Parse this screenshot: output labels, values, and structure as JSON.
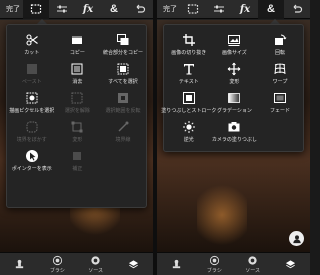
{
  "toolbar": {
    "done_label": "完了"
  },
  "left_menu": {
    "items": [
      {
        "label": "カット",
        "icon": "scissors-icon",
        "disabled": false
      },
      {
        "label": "コピー",
        "icon": "copy-icon",
        "disabled": false
      },
      {
        "label": "統合部分をコピー",
        "icon": "copy-merged-icon",
        "disabled": false
      },
      {
        "label": "ペースト",
        "icon": "paste-icon",
        "disabled": true
      },
      {
        "label": "消去",
        "icon": "clear-icon",
        "disabled": false
      },
      {
        "label": "すべてを選択",
        "icon": "select-all-icon",
        "disabled": false
      },
      {
        "label": "描画ピクセルを選択",
        "icon": "select-pixels-icon",
        "disabled": false
      },
      {
        "label": "選択を解除",
        "icon": "deselect-icon",
        "disabled": true
      },
      {
        "label": "選択範囲を反転",
        "icon": "invert-icon",
        "disabled": true
      },
      {
        "label": "境界をぼかす",
        "icon": "feather-icon",
        "disabled": true
      },
      {
        "label": "変形",
        "icon": "transform-icon",
        "disabled": true
      },
      {
        "label": "境界線",
        "icon": "edge-icon",
        "disabled": true
      },
      {
        "label": "ポインターを表示",
        "icon": "pointer-icon",
        "disabled": false
      },
      {
        "label": "補正",
        "icon": "refine-icon",
        "disabled": true
      }
    ]
  },
  "right_menu": {
    "items": [
      {
        "label": "画像の切り抜き",
        "icon": "crop-icon",
        "disabled": false
      },
      {
        "label": "画像サイズ",
        "icon": "image-size-icon",
        "disabled": false
      },
      {
        "label": "回転",
        "icon": "rotate-icon",
        "disabled": false
      },
      {
        "label": "テキスト",
        "icon": "text-icon",
        "disabled": false
      },
      {
        "label": "変形",
        "icon": "move-icon",
        "disabled": false
      },
      {
        "label": "ワープ",
        "icon": "warp-icon",
        "disabled": false
      },
      {
        "label": "塗りつぶしとストローク",
        "icon": "fill-stroke-icon",
        "disabled": false
      },
      {
        "label": "グラデーション",
        "icon": "gradient-icon",
        "disabled": false
      },
      {
        "label": "フェード",
        "icon": "fade-icon",
        "disabled": false
      },
      {
        "label": "逆光",
        "icon": "backlight-icon",
        "disabled": false
      },
      {
        "label": "カメラの塗りつぶし",
        "icon": "camera-fill-icon",
        "disabled": false
      }
    ]
  },
  "bottombar": {
    "brush_label": "ブラシ",
    "source_label": "ソース"
  },
  "colors": {
    "panel_bg": "#242424",
    "toolbar_bg": "#2b2b2b"
  }
}
